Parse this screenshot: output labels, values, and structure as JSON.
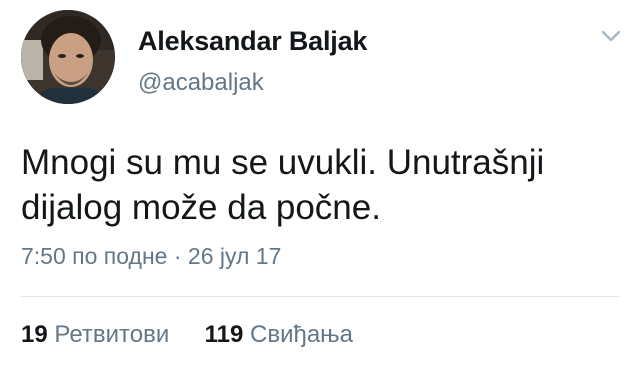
{
  "tweet": {
    "author_name": "Aleksandar Baljak",
    "author_handle": "@acabaljak",
    "text_line1": "Mnogi su mu se uvukli. Unutrašnji",
    "text_line2": "dijalog može da počne.",
    "time": "7:50 по подне",
    "separator": "·",
    "date": "26 јул 17",
    "retweets_count": "19",
    "retweets_label": "Ретвитови",
    "likes_count": "119",
    "likes_label": "Свиђања"
  },
  "icons": {
    "menu": "chevron-down-icon",
    "avatar": "profile-photo"
  },
  "colors": {
    "text_primary": "#14171a",
    "text_secondary": "#657786",
    "divider": "#e1e8ed",
    "chevron": "#aab8c2"
  }
}
